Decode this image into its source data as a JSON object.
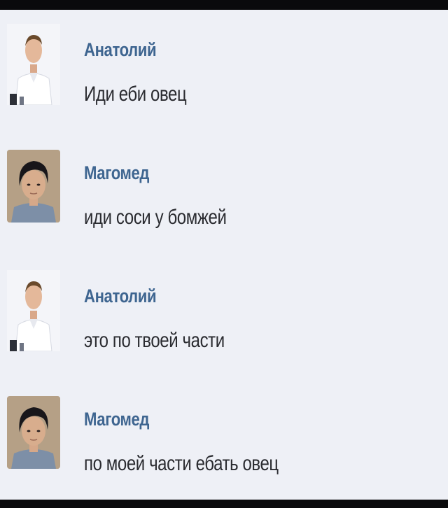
{
  "chat": {
    "messages": [
      {
        "sender": "Анатолий",
        "text": "Иди еби овец",
        "avatar": "anatoly-photo"
      },
      {
        "sender": "Магомед",
        "text": "иди соси у бомжей",
        "avatar": "magomed-photo"
      },
      {
        "sender": "Анатолий",
        "text": "это по твоей части",
        "avatar": "anatoly-photo"
      },
      {
        "sender": "Магомед",
        "text": "по моей части ебать овец",
        "avatar": "magomed-photo"
      }
    ]
  },
  "colors": {
    "background": "#eef0f6",
    "sender_name": "#3e6590",
    "message_text": "#2a2b30",
    "border": "#0a0a0c"
  }
}
